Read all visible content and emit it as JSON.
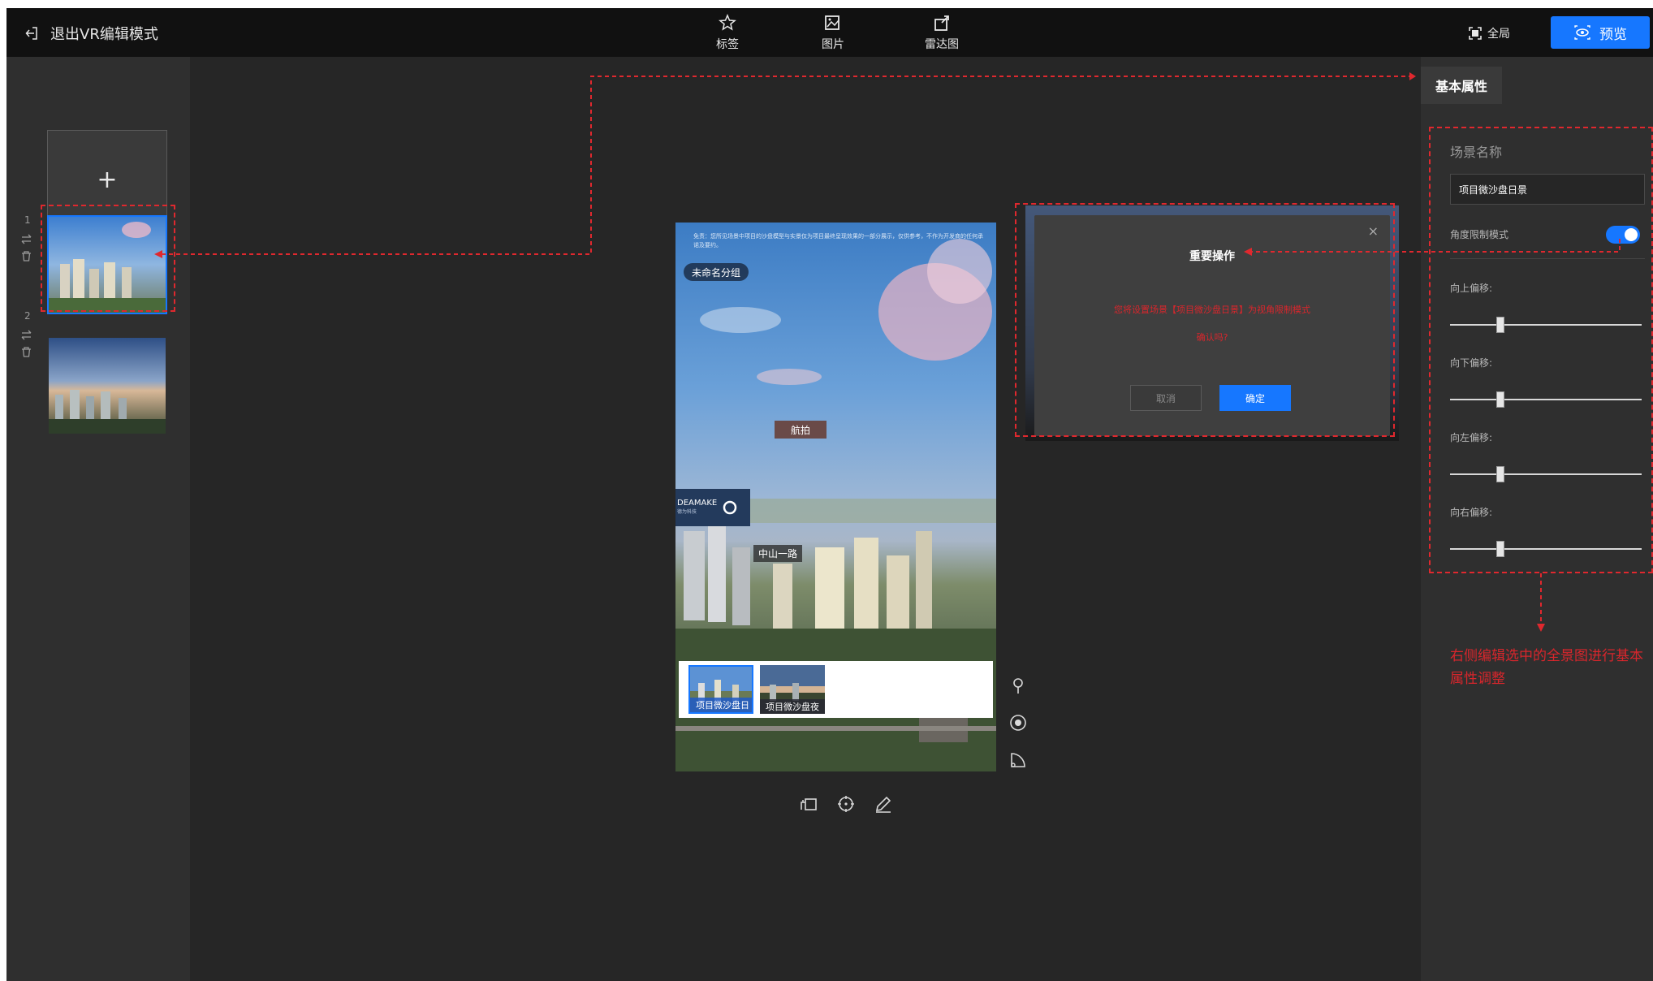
{
  "topbar": {
    "exit_label": "退出VR编辑模式",
    "tools": [
      {
        "label": "标签",
        "icon": "pin-star-icon"
      },
      {
        "label": "图片",
        "icon": "image-add-icon"
      },
      {
        "label": "雷达图",
        "icon": "radar-export-icon"
      }
    ],
    "fullscreen_label": "全局",
    "preview_label": "预览"
  },
  "scenes": {
    "add_label": "+",
    "items": [
      {
        "index": "1",
        "active": true
      },
      {
        "index": "2",
        "active": false
      }
    ]
  },
  "phone": {
    "notice": "免责：您所见场景中项目的沙盘模型与实景仅为项目最终呈现效果的一部分展示，仅供参考，不作为开发商的任何承诺及要约。",
    "group_pill": "未命名分组",
    "hotspot_hangbo": "航拍",
    "hotspot_road": "中山一路",
    "brand_name": "DEAMAKE",
    "brand_sub": "德为科技",
    "thumbs": [
      {
        "label": "项目微沙盘日"
      },
      {
        "label": "项目微沙盘夜"
      }
    ]
  },
  "modal": {
    "close": "×",
    "title": "重要操作",
    "message_line1": "您将设置场景【项目微沙盘日景】为视角限制模式",
    "message_line2": "确认吗?",
    "cancel_label": "取消",
    "ok_label": "确定"
  },
  "right_panel": {
    "tab_label": "基本属性",
    "scene_name_label": "场景名称",
    "scene_name_value": "项目微沙盘日景",
    "angle_mode_label": "角度限制模式",
    "angle_mode_on": true,
    "sliders": [
      {
        "label": "向上偏移:",
        "value": 0.25
      },
      {
        "label": "向下偏移:",
        "value": 0.25
      },
      {
        "label": "向左偏移:",
        "value": 0.25
      },
      {
        "label": "向右偏移:",
        "value": 0.25
      }
    ],
    "annotation": "右侧编辑选中的全景图进行基本属性调整"
  },
  "colors": {
    "accent": "#1677ff",
    "annotation_red": "#e0282e",
    "topbar_bg": "#111111",
    "canvas_bg": "#262626",
    "panel_bg": "#2f2f2f"
  }
}
